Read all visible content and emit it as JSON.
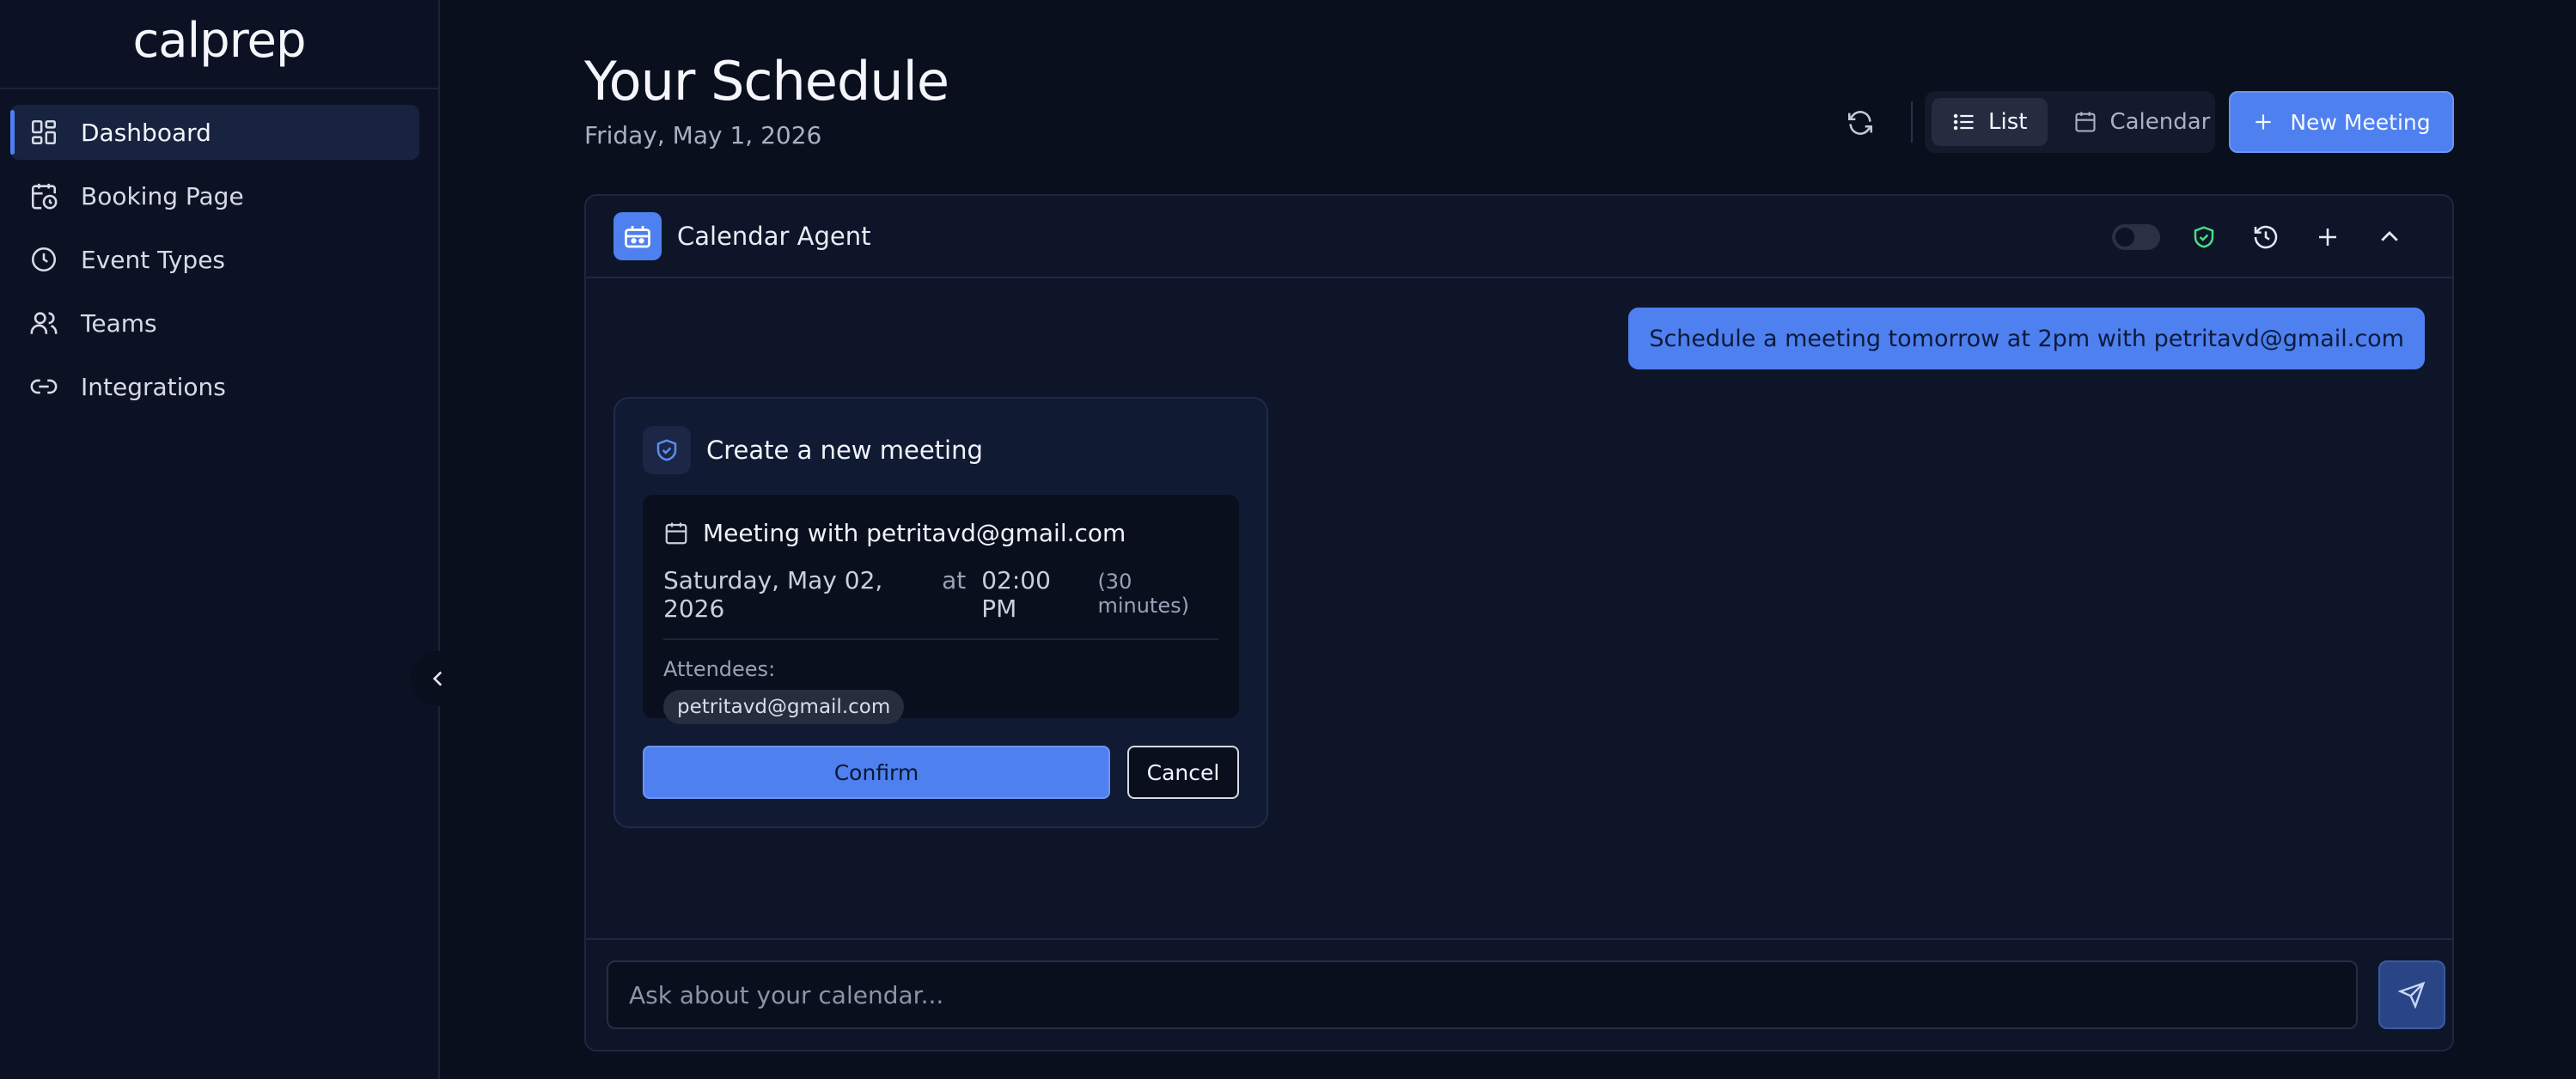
{
  "app": {
    "logo": "calprep"
  },
  "sidebar": {
    "items": [
      {
        "label": "Dashboard",
        "icon": "dashboard-icon",
        "active": true
      },
      {
        "label": "Booking Page",
        "icon": "calendar-clock-icon"
      },
      {
        "label": "Event Types",
        "icon": "clock-icon"
      },
      {
        "label": "Teams",
        "icon": "users-icon"
      },
      {
        "label": "Integrations",
        "icon": "link-icon"
      }
    ],
    "collapse_icon": "chevron-left-icon"
  },
  "header": {
    "title": "Your Schedule",
    "date": "Friday, May 1, 2026",
    "view_list": "List",
    "view_calendar": "Calendar",
    "new_meeting": "New Meeting"
  },
  "agent": {
    "title": "Calendar Agent",
    "user_message": "Schedule a meeting tomorrow at 2pm with petritavd@gmail.com",
    "card": {
      "title": "Create a new meeting",
      "meeting_title": "Meeting with petritavd@gmail.com",
      "date": "Saturday, May 02, 2026",
      "at": "at",
      "time": "02:00 PM",
      "duration": "(30 minutes)",
      "attendees_label": "Attendees:",
      "attendees": [
        "petritavd@gmail.com"
      ],
      "confirm": "Confirm",
      "cancel": "Cancel"
    },
    "input_placeholder": "Ask about your calendar..."
  },
  "colors": {
    "background": "#0a0f1e",
    "accent": "#4e80ef",
    "shield_green": "#4ade80"
  }
}
